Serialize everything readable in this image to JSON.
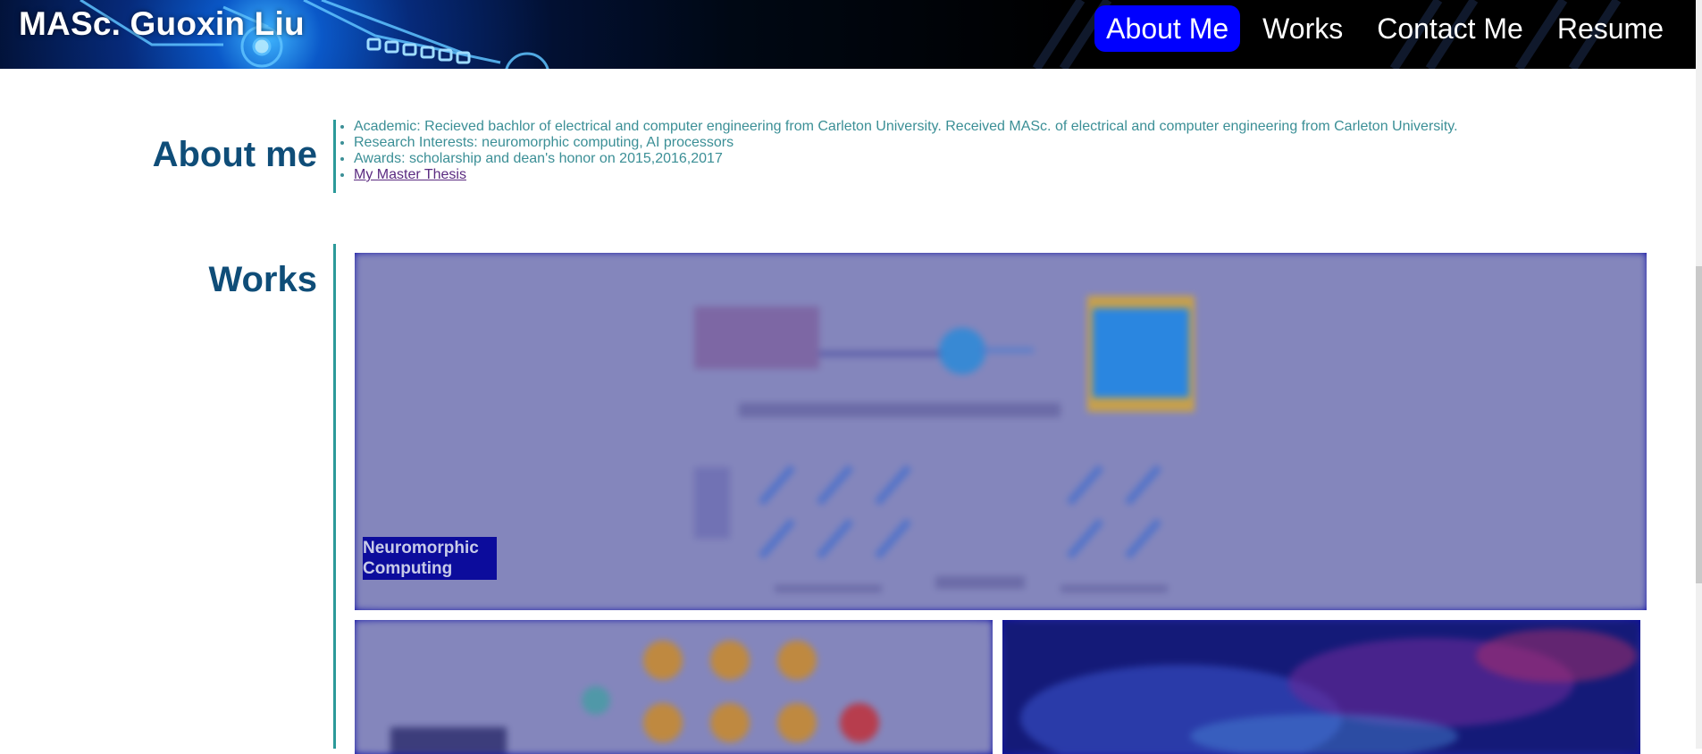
{
  "header": {
    "brand": "MASc. Guoxin Liu",
    "nav": [
      {
        "label": "About Me",
        "active": true
      },
      {
        "label": "Works",
        "active": false
      },
      {
        "label": "Contact Me",
        "active": false
      },
      {
        "label": "Resume",
        "active": false
      }
    ]
  },
  "about": {
    "title": "About me",
    "items": [
      "Academic: Recieved bachlor of electrical and computer engineering from Carleton University. Received MASc. of electrical and computer engineering from Carleton University.",
      "Research Interests: neuromorphic computing, AI processors",
      "Awards: scholarship and dean's honor on 2015,2016,2017"
    ],
    "link": "My Master Thesis"
  },
  "works": {
    "title": "Works",
    "tiles": [
      {
        "caption": "Neuromorphic Computing"
      },
      {
        "caption": ""
      },
      {
        "caption": ""
      }
    ]
  },
  "colors": {
    "accent": "#0000ff",
    "heading": "#0f4d78",
    "rule": "#2b9a9a",
    "tile_overlay": "#0b0ba8"
  }
}
